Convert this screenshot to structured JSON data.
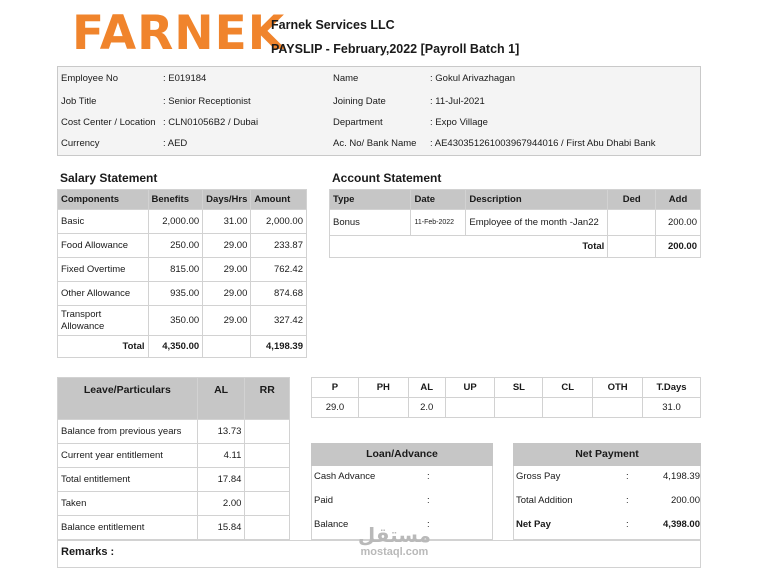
{
  "header": {
    "logo_text": "FARNEK",
    "company": "Farnek Services LLC",
    "payslip_title": "PAYSLIP - February,2022 [Payroll Batch 1]"
  },
  "employee": {
    "left": [
      {
        "label": "Employee No",
        "value": ": E019184"
      },
      {
        "label": "Job Title",
        "value": ": Senior Receptionist"
      },
      {
        "label": "Cost Center / Location",
        "value": ": CLN01056B2 / Dubai"
      },
      {
        "label": "Currency",
        "value": ": AED"
      }
    ],
    "right": [
      {
        "label": "Name",
        "value": ": Gokul Arivazhagan"
      },
      {
        "label": "Joining Date",
        "value": ": 11-Jul-2021"
      },
      {
        "label": "Department",
        "value": ": Expo Village"
      },
      {
        "label": "Ac. No/ Bank Name",
        "value": ": AE430351261003967944016 / First Abu Dhabi Bank"
      }
    ]
  },
  "salary": {
    "title": "Salary Statement",
    "headers": [
      "Components",
      "Benefits",
      "Days/Hrs",
      "Amount"
    ],
    "rows": [
      {
        "component": "Basic",
        "benefits": "2,000.00",
        "days": "31.00",
        "amount": "2,000.00"
      },
      {
        "component": "Food Allowance",
        "benefits": "250.00",
        "days": "29.00",
        "amount": "233.87"
      },
      {
        "component": "Fixed Overtime",
        "benefits": "815.00",
        "days": "29.00",
        "amount": "762.42"
      },
      {
        "component": "Other Allowance",
        "benefits": "935.00",
        "days": "29.00",
        "amount": "874.68"
      },
      {
        "component": "Transport Allowance",
        "benefits": "350.00",
        "days": "29.00",
        "amount": "327.42"
      }
    ],
    "total_label": "Total",
    "total_benefits": "4,350.00",
    "total_amount": "4,198.39"
  },
  "account": {
    "title": "Account Statement",
    "headers": [
      "Type",
      "Date",
      "Description",
      "Ded",
      "Add"
    ],
    "rows": [
      {
        "type": "Bonus",
        "date": "11-Feb-2022",
        "description": "Employee of the month -Jan22",
        "ded": "",
        "add": "200.00"
      }
    ],
    "total_label": "Total",
    "total_add": "200.00"
  },
  "leave": {
    "headers": [
      "Leave/Particulars",
      "AL",
      "RR"
    ],
    "rows": [
      {
        "label": "Balance from previous years",
        "al": "13.73",
        "rr": ""
      },
      {
        "label": "Current year entitlement",
        "al": "4.11",
        "rr": ""
      },
      {
        "label": "Total entitlement",
        "al": "17.84",
        "rr": ""
      },
      {
        "label": "Taken",
        "al": "2.00",
        "rr": ""
      },
      {
        "label": "Balance entitlement",
        "al": "15.84",
        "rr": ""
      }
    ]
  },
  "attendance": {
    "headers": [
      "P",
      "PH",
      "AL",
      "UP",
      "SL",
      "CL",
      "OTH",
      "T.Days"
    ],
    "values": [
      "29.0",
      "",
      "2.0",
      "",
      "",
      "",
      "",
      "31.0"
    ]
  },
  "loan": {
    "title": "Loan/Advance",
    "rows": [
      {
        "label": "Cash Advance",
        "sep": ":",
        "value": ""
      },
      {
        "label": "Paid",
        "sep": ":",
        "value": ""
      },
      {
        "label": "Balance",
        "sep": ":",
        "value": ""
      }
    ]
  },
  "net": {
    "title": "Net Payment",
    "rows": [
      {
        "label": "Gross Pay",
        "sep": ":",
        "value": "4,198.39"
      },
      {
        "label": "Total Addition",
        "sep": ":",
        "value": "200.00"
      },
      {
        "label": "Net Pay",
        "sep": ":",
        "value": "4,398.00"
      }
    ]
  },
  "remarks": {
    "label": "Remarks :"
  },
  "watermark": {
    "arabic": "مستقل",
    "latin": "mostaql.com"
  },
  "colors": {
    "brand": "#f0842c",
    "header_fill": "#c6c6c6",
    "info_fill": "#f4f4f4"
  }
}
